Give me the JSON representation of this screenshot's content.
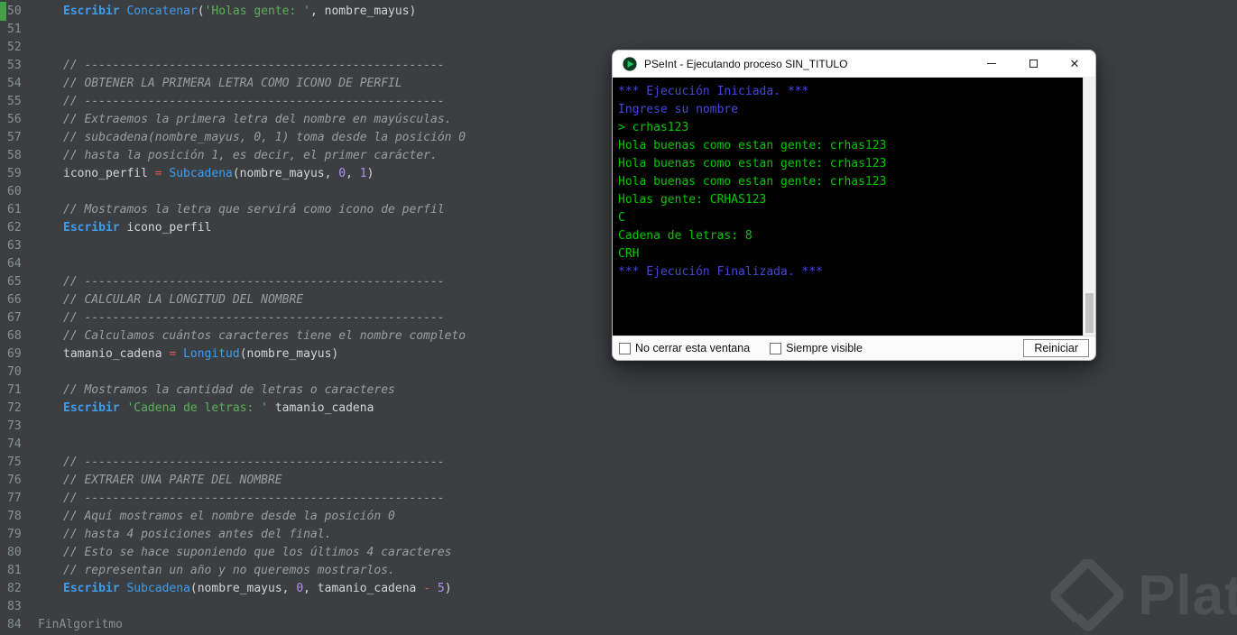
{
  "editor": {
    "lines": [
      {
        "n": "50",
        "ind": 1,
        "segs": [
          [
            "kw",
            "Escribir"
          ],
          [
            "pl",
            " "
          ],
          [
            "fn",
            "Concatenar"
          ],
          [
            "pl",
            "("
          ],
          [
            "str",
            "'Holas gente: '"
          ],
          [
            "pl",
            ", nombre_mayus)"
          ]
        ]
      },
      {
        "n": "51",
        "ind": 1,
        "segs": []
      },
      {
        "n": "52",
        "ind": 1,
        "segs": []
      },
      {
        "n": "53",
        "ind": 1,
        "segs": [
          [
            "cm",
            "// ---------------------------------------------------"
          ]
        ]
      },
      {
        "n": "54",
        "ind": 1,
        "segs": [
          [
            "cm",
            "// OBTENER LA PRIMERA LETRA COMO ICONO DE PERFIL"
          ]
        ]
      },
      {
        "n": "55",
        "ind": 1,
        "segs": [
          [
            "cm",
            "// ---------------------------------------------------"
          ]
        ]
      },
      {
        "n": "56",
        "ind": 1,
        "segs": [
          [
            "cm",
            "// Extraemos la primera letra del nombre en mayúsculas."
          ]
        ]
      },
      {
        "n": "57",
        "ind": 1,
        "segs": [
          [
            "cm",
            "// subcadena(nombre_mayus, 0, 1) toma desde la posición 0"
          ]
        ]
      },
      {
        "n": "58",
        "ind": 1,
        "segs": [
          [
            "cm",
            "// hasta la posición 1, es decir, el primer carácter."
          ]
        ]
      },
      {
        "n": "59",
        "ind": 1,
        "segs": [
          [
            "pl",
            "icono_perfil "
          ],
          [
            "op",
            "="
          ],
          [
            "pl",
            " "
          ],
          [
            "fn",
            "Subcadena"
          ],
          [
            "pl",
            "(nombre_mayus, "
          ],
          [
            "num",
            "0"
          ],
          [
            "pl",
            ", "
          ],
          [
            "num",
            "1"
          ],
          [
            "pl",
            ")"
          ]
        ]
      },
      {
        "n": "60",
        "ind": 1,
        "segs": []
      },
      {
        "n": "61",
        "ind": 1,
        "segs": [
          [
            "cm",
            "// Mostramos la letra que servirá como icono de perfil"
          ]
        ]
      },
      {
        "n": "62",
        "ind": 1,
        "segs": [
          [
            "kw",
            "Escribir"
          ],
          [
            "pl",
            " icono_perfil"
          ]
        ]
      },
      {
        "n": "63",
        "ind": 1,
        "segs": []
      },
      {
        "n": "64",
        "ind": 1,
        "segs": []
      },
      {
        "n": "65",
        "ind": 1,
        "segs": [
          [
            "cm",
            "// ---------------------------------------------------"
          ]
        ]
      },
      {
        "n": "66",
        "ind": 1,
        "segs": [
          [
            "cm",
            "// CALCULAR LA LONGITUD DEL NOMBRE"
          ]
        ]
      },
      {
        "n": "67",
        "ind": 1,
        "segs": [
          [
            "cm",
            "// ---------------------------------------------------"
          ]
        ]
      },
      {
        "n": "68",
        "ind": 1,
        "segs": [
          [
            "cm",
            "// Calculamos cuántos caracteres tiene el nombre completo"
          ]
        ]
      },
      {
        "n": "69",
        "ind": 1,
        "segs": [
          [
            "pl",
            "tamanio_cadena "
          ],
          [
            "op",
            "="
          ],
          [
            "pl",
            " "
          ],
          [
            "fn",
            "Longitud"
          ],
          [
            "pl",
            "(nombre_mayus)"
          ]
        ]
      },
      {
        "n": "70",
        "ind": 1,
        "segs": []
      },
      {
        "n": "71",
        "ind": 1,
        "segs": [
          [
            "cm",
            "// Mostramos la cantidad de letras o caracteres"
          ]
        ]
      },
      {
        "n": "72",
        "ind": 1,
        "segs": [
          [
            "kw",
            "Escribir"
          ],
          [
            "pl",
            " "
          ],
          [
            "str",
            "'Cadena de letras: '"
          ],
          [
            "pl",
            " tamanio_cadena"
          ]
        ]
      },
      {
        "n": "73",
        "ind": 1,
        "segs": []
      },
      {
        "n": "74",
        "ind": 1,
        "segs": []
      },
      {
        "n": "75",
        "ind": 1,
        "segs": [
          [
            "cm",
            "// ---------------------------------------------------"
          ]
        ]
      },
      {
        "n": "76",
        "ind": 1,
        "segs": [
          [
            "cm",
            "// EXTRAER UNA PARTE DEL NOMBRE"
          ]
        ]
      },
      {
        "n": "77",
        "ind": 1,
        "segs": [
          [
            "cm",
            "// ---------------------------------------------------"
          ]
        ]
      },
      {
        "n": "78",
        "ind": 1,
        "segs": [
          [
            "cm",
            "// Aquí mostramos el nombre desde la posición 0"
          ]
        ]
      },
      {
        "n": "79",
        "ind": 1,
        "segs": [
          [
            "cm",
            "// hasta 4 posiciones antes del final."
          ]
        ]
      },
      {
        "n": "80",
        "ind": 1,
        "segs": [
          [
            "cm",
            "// Esto se hace suponiendo que los últimos 4 caracteres"
          ]
        ]
      },
      {
        "n": "81",
        "ind": 1,
        "segs": [
          [
            "cm",
            "// representan un año y no queremos mostrarlos."
          ]
        ]
      },
      {
        "n": "82",
        "ind": 1,
        "segs": [
          [
            "kw",
            "Escribir"
          ],
          [
            "pl",
            " "
          ],
          [
            "fn",
            "Subcadena"
          ],
          [
            "pl",
            "(nombre_mayus, "
          ],
          [
            "num",
            "0"
          ],
          [
            "pl",
            ", tamanio_cadena "
          ],
          [
            "op",
            "-"
          ],
          [
            "pl",
            " "
          ],
          [
            "num",
            "5"
          ],
          [
            "pl",
            ")"
          ]
        ]
      },
      {
        "n": "83",
        "ind": 1,
        "segs": []
      },
      {
        "n": "84",
        "ind": 0,
        "segs": [
          [
            "dim",
            "FinAlgoritmo"
          ]
        ]
      }
    ]
  },
  "console_window": {
    "title": "PSeInt - Ejecutando proceso SIN_TITULO",
    "lines": [
      {
        "c": "sys",
        "t": "*** Ejecución Iniciada. ***"
      },
      {
        "c": "sys",
        "t": "Ingrese su nombre"
      },
      {
        "c": "usr",
        "t": "> crhas123"
      },
      {
        "c": "out",
        "t": "Hola buenas como estan gente: crhas123"
      },
      {
        "c": "out",
        "t": "Hola buenas como estan gente: crhas123"
      },
      {
        "c": "out",
        "t": "Hola buenas como estan gente: crhas123"
      },
      {
        "c": "out",
        "t": "Holas gente: CRHAS123"
      },
      {
        "c": "out",
        "t": "C"
      },
      {
        "c": "out",
        "t": "Cadena de letras: 8"
      },
      {
        "c": "out",
        "t": "CRH"
      },
      {
        "c": "sys",
        "t": "*** Ejecución Finalizada. ***"
      }
    ],
    "checkbox_no_close": "No cerrar esta ventana",
    "checkbox_always_visible": "Siempre visible",
    "restart_button": "Reiniciar"
  },
  "icons": {
    "app_icon": "pseint-play-logo",
    "minimize_glyph": "—",
    "maximize_icon": "box-outline",
    "close_glyph": "✕",
    "watermark_icon": "platzi-diamond-logo"
  },
  "watermark": {
    "text": "Platzi"
  },
  "colors": {
    "editor_bg": "#3c3f41",
    "gutter_text": "#8a8f91",
    "plain": "#d4d4d4",
    "keyword": "#3d9bf0",
    "function": "#3d9bf0",
    "string": "#5bae5b",
    "number": "#b48ef2",
    "operator": "#e0564f",
    "comment": "#9c9c9c",
    "marker_green": "#43a047",
    "console_system": "#4646e0",
    "console_user": "#00c800"
  }
}
